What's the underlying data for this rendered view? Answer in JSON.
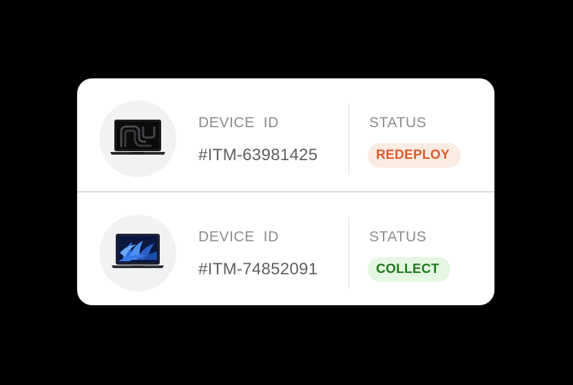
{
  "devices": [
    {
      "image": "macbook-pro-laptop-dark",
      "id_label": "DEVICE  ID",
      "id_value": "#ITM-63981425",
      "status_label": "STATUS",
      "status": "REDEPLOY",
      "status_color": "#e2592a",
      "status_bg": "#fbece3"
    },
    {
      "image": "macbook-air-laptop-blue-wallpaper",
      "id_label": "DEVICE  ID",
      "id_value": "#ITM-74852091",
      "status_label": "STATUS",
      "status": "COLLECT",
      "status_color": "#1b7a1b",
      "status_bg": "#e4f7e0"
    }
  ]
}
